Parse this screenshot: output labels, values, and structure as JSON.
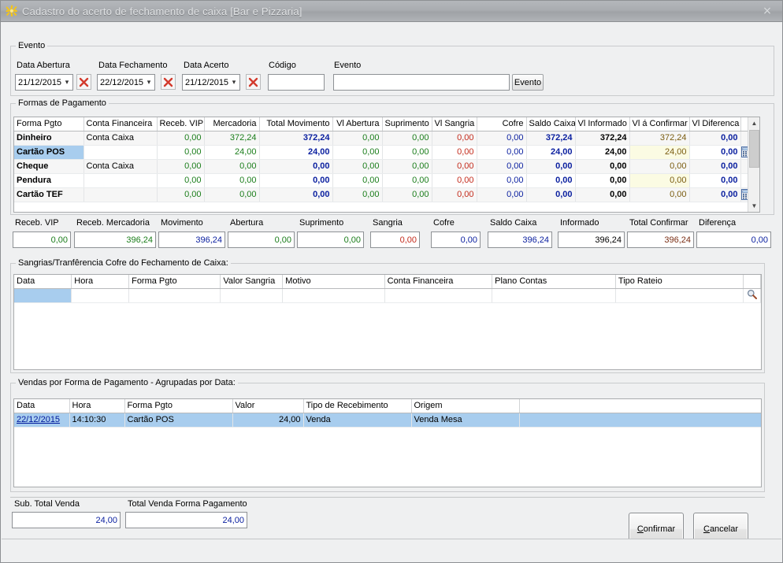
{
  "window": {
    "title": "Cadastro do acerto de fechamento de caixa [Bar e Pizzaria]",
    "close_label": "×",
    "icon": "sparkle-icon"
  },
  "evento_group": {
    "legend": "Evento",
    "data_abertura_label": "Data Abertura",
    "data_abertura_value": "21/12/2015",
    "data_fechamento_label": "Data Fechamento",
    "data_fechamento_value": "22/12/2015",
    "data_acerto_label": "Data Acerto",
    "data_acerto_value": "21/12/2015",
    "codigo_label": "Código",
    "codigo_value": "",
    "evento_label": "Evento",
    "evento_value": "",
    "evento_button": "Evento",
    "clear_icon": "clear-x-icon",
    "dropdown_icon": "chevron-down-icon"
  },
  "formas_pagamento": {
    "legend": "Formas de Pagamento",
    "columns": [
      "Forma Pgto",
      "Conta Financeira",
      "Receb. VIP",
      "Mercadoria",
      "Total Movimento",
      "Vl Abertura",
      "Suprimento",
      "Vl Sangria",
      "Cofre",
      "Saldo Caixa",
      "Vl Informado",
      "Vl á Confirmar",
      "Vl Diferenca",
      ""
    ],
    "rows": [
      {
        "forma": "Dinheiro",
        "conta": "Conta Caixa",
        "vip": "0,00",
        "mercadoria": "372,24",
        "total_mov": "372,24",
        "abertura": "0,00",
        "suprimento": "0,00",
        "sangria": "0,00",
        "cofre": "0,00",
        "saldo": "372,24",
        "informado": "372,24",
        "confirmar": "372,24",
        "diferenca": "0,00",
        "has_icon": false,
        "selected": false
      },
      {
        "forma": "Cartão POS",
        "conta": "",
        "vip": "0,00",
        "mercadoria": "24,00",
        "total_mov": "24,00",
        "abertura": "0,00",
        "suprimento": "0,00",
        "sangria": "0,00",
        "cofre": "0,00",
        "saldo": "24,00",
        "informado": "24,00",
        "confirmar": "24,00",
        "diferenca": "0,00",
        "has_icon": true,
        "selected": true
      },
      {
        "forma": "Cheque",
        "conta": "Conta Caixa",
        "vip": "0,00",
        "mercadoria": "0,00",
        "total_mov": "0,00",
        "abertura": "0,00",
        "suprimento": "0,00",
        "sangria": "0,00",
        "cofre": "0,00",
        "saldo": "0,00",
        "informado": "0,00",
        "confirmar": "0,00",
        "diferenca": "0,00",
        "has_icon": false,
        "selected": false
      },
      {
        "forma": "Pendura",
        "conta": "",
        "vip": "0,00",
        "mercadoria": "0,00",
        "total_mov": "0,00",
        "abertura": "0,00",
        "suprimento": "0,00",
        "sangria": "0,00",
        "cofre": "0,00",
        "saldo": "0,00",
        "informado": "0,00",
        "confirmar": "0,00",
        "diferenca": "0,00",
        "has_icon": false,
        "selected": false
      },
      {
        "forma": "Cartão TEF",
        "conta": "",
        "vip": "0,00",
        "mercadoria": "0,00",
        "total_mov": "0,00",
        "abertura": "0,00",
        "suprimento": "0,00",
        "sangria": "0,00",
        "cofre": "0,00",
        "saldo": "0,00",
        "informado": "0,00",
        "confirmar": "0,00",
        "diferenca": "0,00",
        "has_icon": true,
        "selected": false
      }
    ]
  },
  "totais": {
    "receb_vip_label": "Receb. VIP",
    "receb_vip_value": "0,00",
    "receb_mercadoria_label": "Receb. Mercadoria",
    "receb_mercadoria_value": "396,24",
    "movimento_label": "Movimento",
    "movimento_value": "396,24",
    "abertura_label": "Abertura",
    "abertura_value": "0,00",
    "suprimento_label": "Suprimento",
    "suprimento_value": "0,00",
    "sangria_label": "Sangria",
    "sangria_value": "0,00",
    "cofre_label": "Cofre",
    "cofre_value": "0,00",
    "saldo_caixa_label": "Saldo Caixa",
    "saldo_caixa_value": "396,24",
    "informado_label": "Informado",
    "informado_value": "396,24",
    "total_confirmar_label": "Total Confirmar",
    "total_confirmar_value": "396,24",
    "diferenca_label": "Diferença",
    "diferenca_value": "0,00"
  },
  "sangrias": {
    "title": "Sangrias/Tranfêrencia Cofre do Fechamento de Caixa:",
    "columns": [
      "Data",
      "Hora",
      "Forma Pgto",
      "Valor Sangria",
      "Motivo",
      "Conta Financeira",
      "Plano Contas",
      "Tipo Rateio",
      ""
    ],
    "rows": [
      {
        "data": "",
        "hora": "",
        "forma": "",
        "valor": "",
        "motivo": "",
        "conta": "",
        "plano": "",
        "rateio": "",
        "search_icon": "magnifier-icon"
      }
    ]
  },
  "vendas": {
    "title": "Vendas por Forma de Pagamento -  Agrupadas por Data:",
    "columns": [
      "Data",
      "Hora",
      "Forma Pgto",
      "Valor",
      "Tipo de Recebimento",
      "Origem"
    ],
    "rows": [
      {
        "data": "22/12/2015",
        "hora": "14:10:30",
        "forma": "Cartão POS",
        "valor": "24,00",
        "tipo": "Venda",
        "origem": "Venda Mesa",
        "selected": true
      }
    ]
  },
  "rodape": {
    "sub_total_venda_label": "Sub. Total Venda",
    "sub_total_venda_value": "24,00",
    "total_venda_forma_label": "Total Venda Forma Pagamento",
    "total_venda_forma_value": "24,00",
    "confirmar_accel": "C",
    "confirmar_rest": "onfirmar",
    "cancelar_accel": "C",
    "cancelar_rest": "ancelar"
  },
  "colors": {
    "accent_selection": "#a8cdee",
    "green_value": "#1a7d1a",
    "blue_value": "#0c21a0",
    "red_value": "#c42b1c",
    "confirm_bg": "#fbfbe3"
  }
}
